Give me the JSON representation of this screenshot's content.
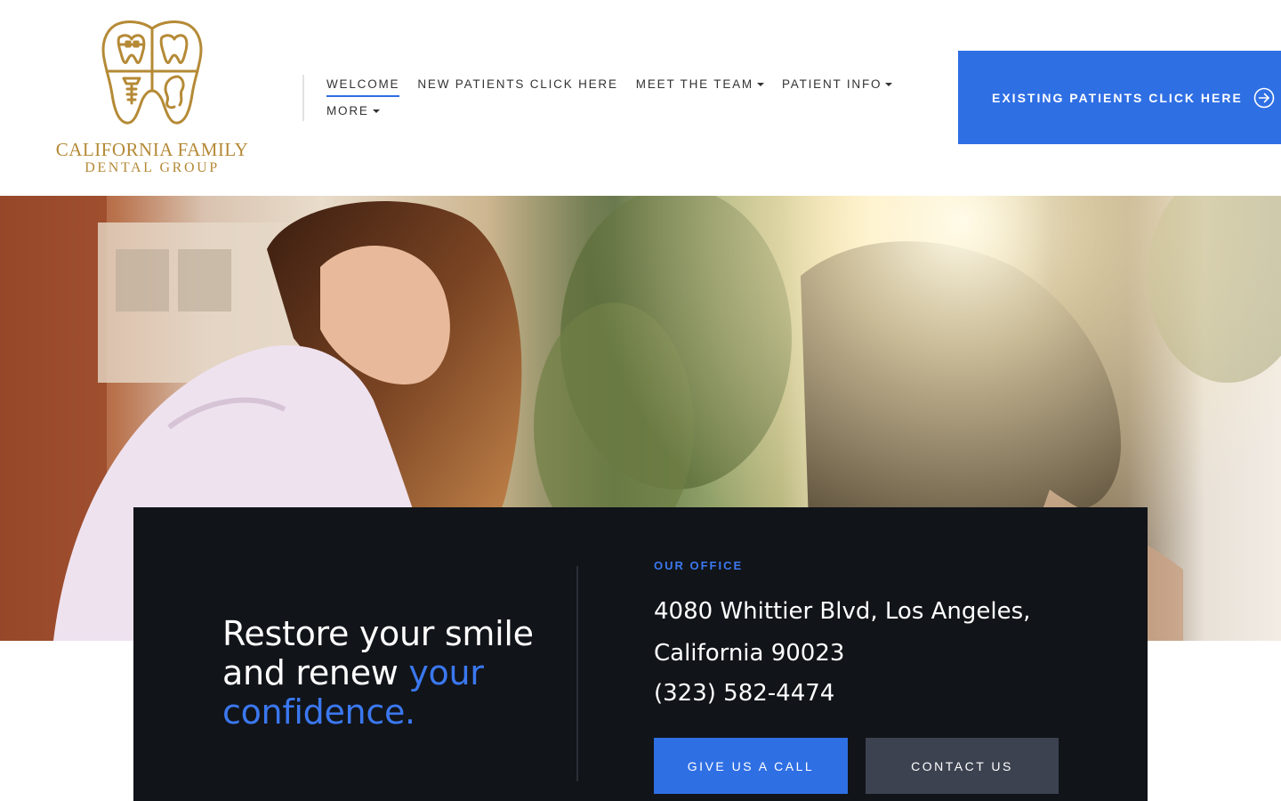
{
  "brand": {
    "line1": "CALIFORNIA FAMILY",
    "line2": "DENTAL GROUP",
    "logo_icon": "tooth-logo-icon",
    "gold": "#b58a36"
  },
  "nav": {
    "items": [
      {
        "label": "WELCOME",
        "active": true,
        "dropdown": false
      },
      {
        "label": "NEW PATIENTS CLICK HERE",
        "active": false,
        "dropdown": false
      },
      {
        "label": "MEET THE TEAM",
        "active": false,
        "dropdown": true
      },
      {
        "label": "PATIENT INFO",
        "active": false,
        "dropdown": true
      },
      {
        "label": "MORE",
        "active": false,
        "dropdown": true
      }
    ]
  },
  "cta": {
    "existing_label": "EXISTING PATIENTS CLICK HERE",
    "icon": "arrow-right-circle-icon"
  },
  "hero": {
    "image": "smiling woman signing paper outdoors in sunlight"
  },
  "card": {
    "tagline_part1": "Restore your smile and renew ",
    "tagline_accent": "your confidence.",
    "office_label": "OUR OFFICE",
    "address_line1": "4080 Whittier Blvd, Los Angeles,",
    "address_line2": "California 90023",
    "phone": "(323) 582-4474",
    "call_button": "GIVE US A CALL",
    "contact_button": "CONTACT US"
  },
  "colors": {
    "accent": "#2f6fe4",
    "card_bg": "#111419",
    "contact_bg": "#3c4250"
  }
}
